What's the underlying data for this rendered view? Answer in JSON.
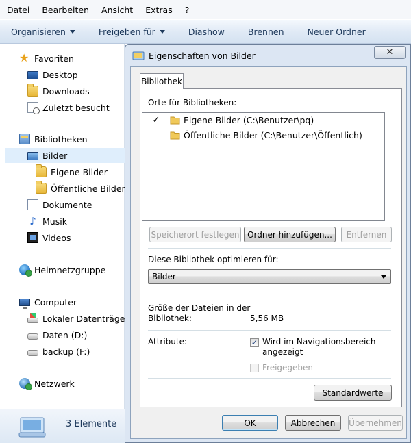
{
  "menubar": {
    "items": [
      "Datei",
      "Bearbeiten",
      "Ansicht",
      "Extras",
      "?"
    ]
  },
  "toolbar": {
    "organize": "Organisieren",
    "share": "Freigeben für",
    "slideshow": "Diashow",
    "burn": "Brennen",
    "new_folder": "Neuer Ordner"
  },
  "nav": {
    "favorites": "Favoriten",
    "desktop": "Desktop",
    "downloads": "Downloads",
    "recent": "Zuletzt besucht",
    "libraries": "Bibliotheken",
    "pictures": "Bilder",
    "my_pictures": "Eigene Bilder",
    "public_pictures": "Öffentliche Bilder",
    "documents": "Dokumente",
    "music": "Musik",
    "videos": "Videos",
    "homegroup": "Heimnetzgruppe",
    "computer": "Computer",
    "local_disk": "Lokaler Datenträger",
    "data_drive": "Daten (D:)",
    "backup_drive": "backup (F:)",
    "network": "Netzwerk"
  },
  "status": {
    "count": "3 Elemente"
  },
  "dialog": {
    "title": "Eigenschaften von Bilder",
    "close_glyph": "✕",
    "tab": "Bibliothek",
    "locations_label": "Orte für Bibliotheken:",
    "locations": [
      {
        "check": "✓",
        "path": "Eigene Bilder (C:\\Benutzer\\pq)"
      },
      {
        "check": "",
        "path": "Öffentliche Bilder (C:\\Benutzer\\Öffentlich)"
      }
    ],
    "btn_set_location": "Speicherort festlegen",
    "btn_add_folder": "Ordner hinzufügen...",
    "btn_remove": "Entfernen",
    "optimize_label": "Diese Bibliothek optimieren für:",
    "optimize_value": "Bilder",
    "size_label_1": "Größe der Dateien in der",
    "size_label_2": "Bibliothek:",
    "size_value": "5,56 MB",
    "attributes_label": "Attribute:",
    "attr_nav_1": "Wird im Navigationsbereich",
    "attr_nav_2": "angezeigt",
    "attr_nav_checked": "✓",
    "attr_shared": "Freigegeben",
    "btn_defaults": "Standardwerte",
    "btn_ok": "OK",
    "btn_cancel": "Abbrechen",
    "btn_apply": "Übernehmen"
  }
}
